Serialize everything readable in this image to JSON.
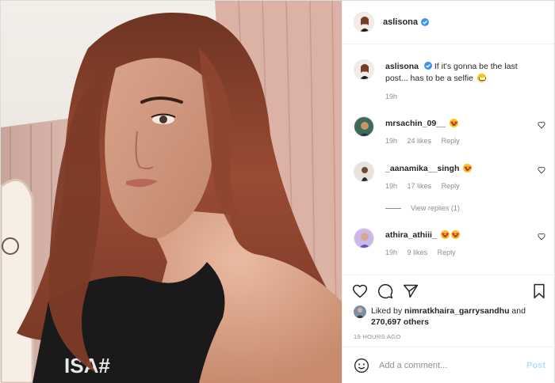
{
  "post": {
    "author": "aslisona",
    "verified": true,
    "photo_shirt_text": "ISA#"
  },
  "caption": {
    "username": "aslisona",
    "text": "If it's gonna be the last post... has to be a selfie",
    "emoji": "grinning-sweat-emoji",
    "time": "19h"
  },
  "comments": [
    {
      "username": "mrsachin_09__",
      "emoji": "heart-eyes-emoji",
      "time": "19h",
      "likes": "24 likes",
      "reply": "Reply"
    },
    {
      "username": "_aanamika__singh",
      "emoji": "heart-eyes-emoji",
      "time": "19h",
      "likes": "17 likes",
      "reply": "Reply"
    },
    {
      "username": "athira_athiii_",
      "emoji": "heart-eyes-emoji x2",
      "time": "19h",
      "likes": "9 likes",
      "reply": "Reply"
    }
  ],
  "view_replies": "View replies (1)",
  "likes": {
    "prefix": "Liked by",
    "liker": "nimratkhaira_garrysandhu",
    "connector": "and",
    "count": "270,697 others"
  },
  "timestamp": "19 HOURS AGO",
  "add_comment": {
    "placeholder": "Add a comment...",
    "post_label": "Post"
  },
  "colors": {
    "accent": "#0095f6",
    "post_disabled": "#b2dffc",
    "muted": "#8e8e8e",
    "verified": "#3897f0"
  },
  "icons": [
    "heart-icon",
    "comment-icon",
    "share-icon",
    "bookmark-icon",
    "smile-icon",
    "verified-icon"
  ]
}
